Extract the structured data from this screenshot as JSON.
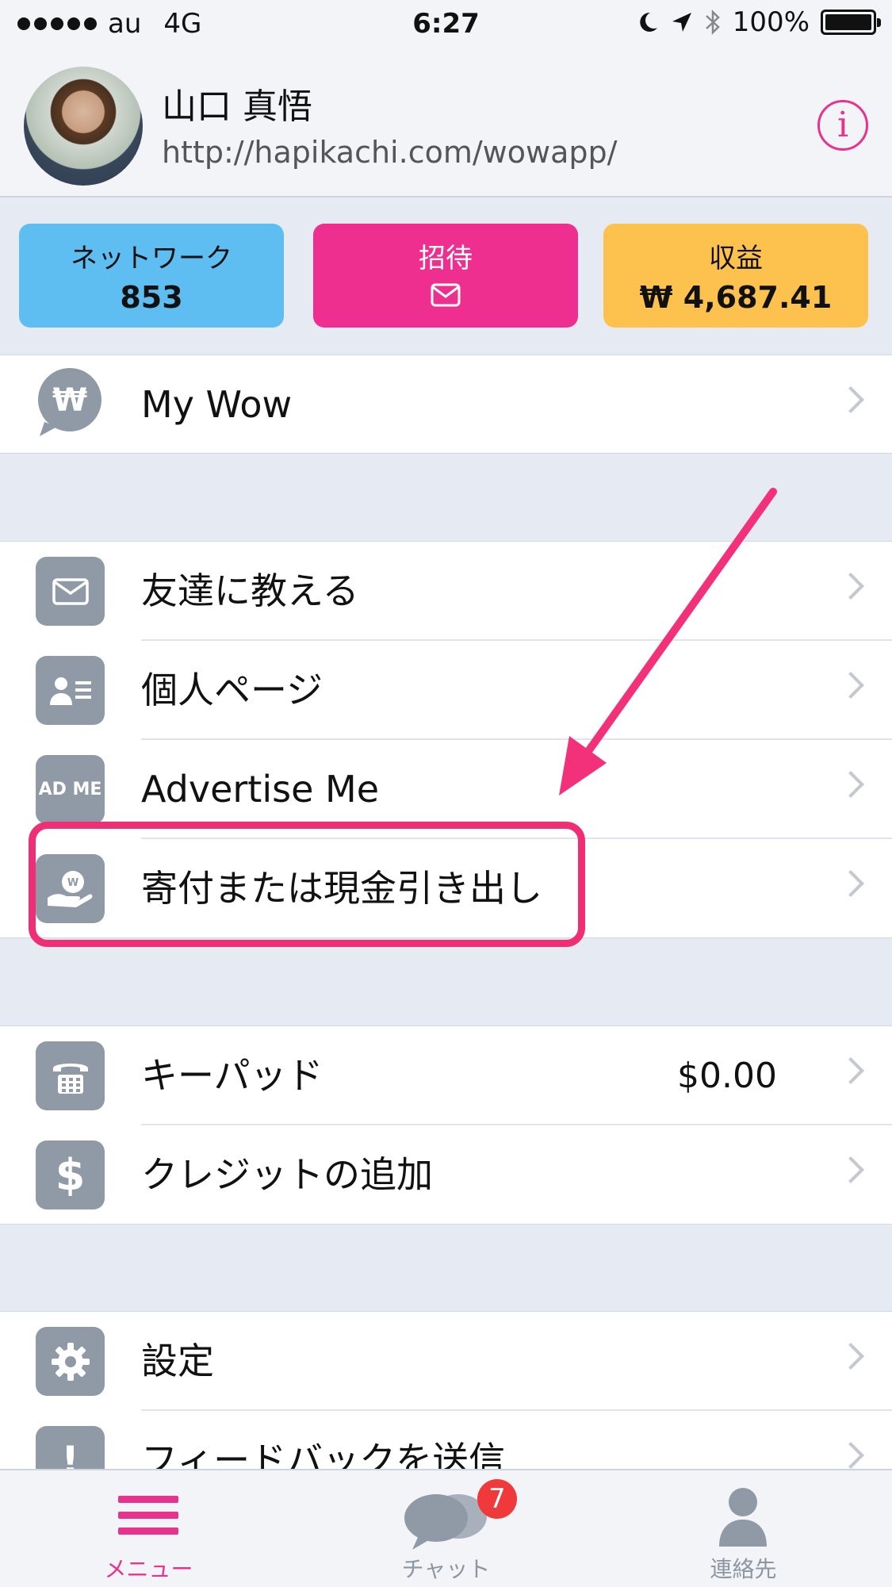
{
  "status_bar": {
    "carrier": "au",
    "network": "4G",
    "time": "6:27",
    "battery": "100%"
  },
  "profile": {
    "name": "山口 真悟",
    "url": "http://hapikachi.com/wowapp/",
    "info_icon": "info-icon"
  },
  "cards": {
    "network": {
      "label": "ネットワーク",
      "value": "853"
    },
    "invite": {
      "label": "招待",
      "icon": "envelope-icon"
    },
    "earnings": {
      "label": "収益",
      "value": "₩ 4,687.41"
    }
  },
  "menu": {
    "my_wow": "My Wow",
    "tell_friends": "友達に教える",
    "personal_page": "個人ページ",
    "advertise_me": "Advertise Me",
    "advertise_icon_text": "AD ME",
    "donate_withdraw": "寄付または現金引き出し",
    "keypad": "キーパッド",
    "keypad_balance": "$0.00",
    "add_credit": "クレジットの追加",
    "settings": "設定",
    "feedback": "フィードバックを送信"
  },
  "tabbar": {
    "menu": "メニュー",
    "chat": "チャット",
    "chat_badge": "7",
    "contacts": "連絡先"
  },
  "colors": {
    "accent": "#e8338e",
    "network_card": "#5ebdf1",
    "invite_card": "#ee2f8f",
    "earnings_card": "#fdc24d",
    "icon_gray": "#8f9aa6"
  }
}
